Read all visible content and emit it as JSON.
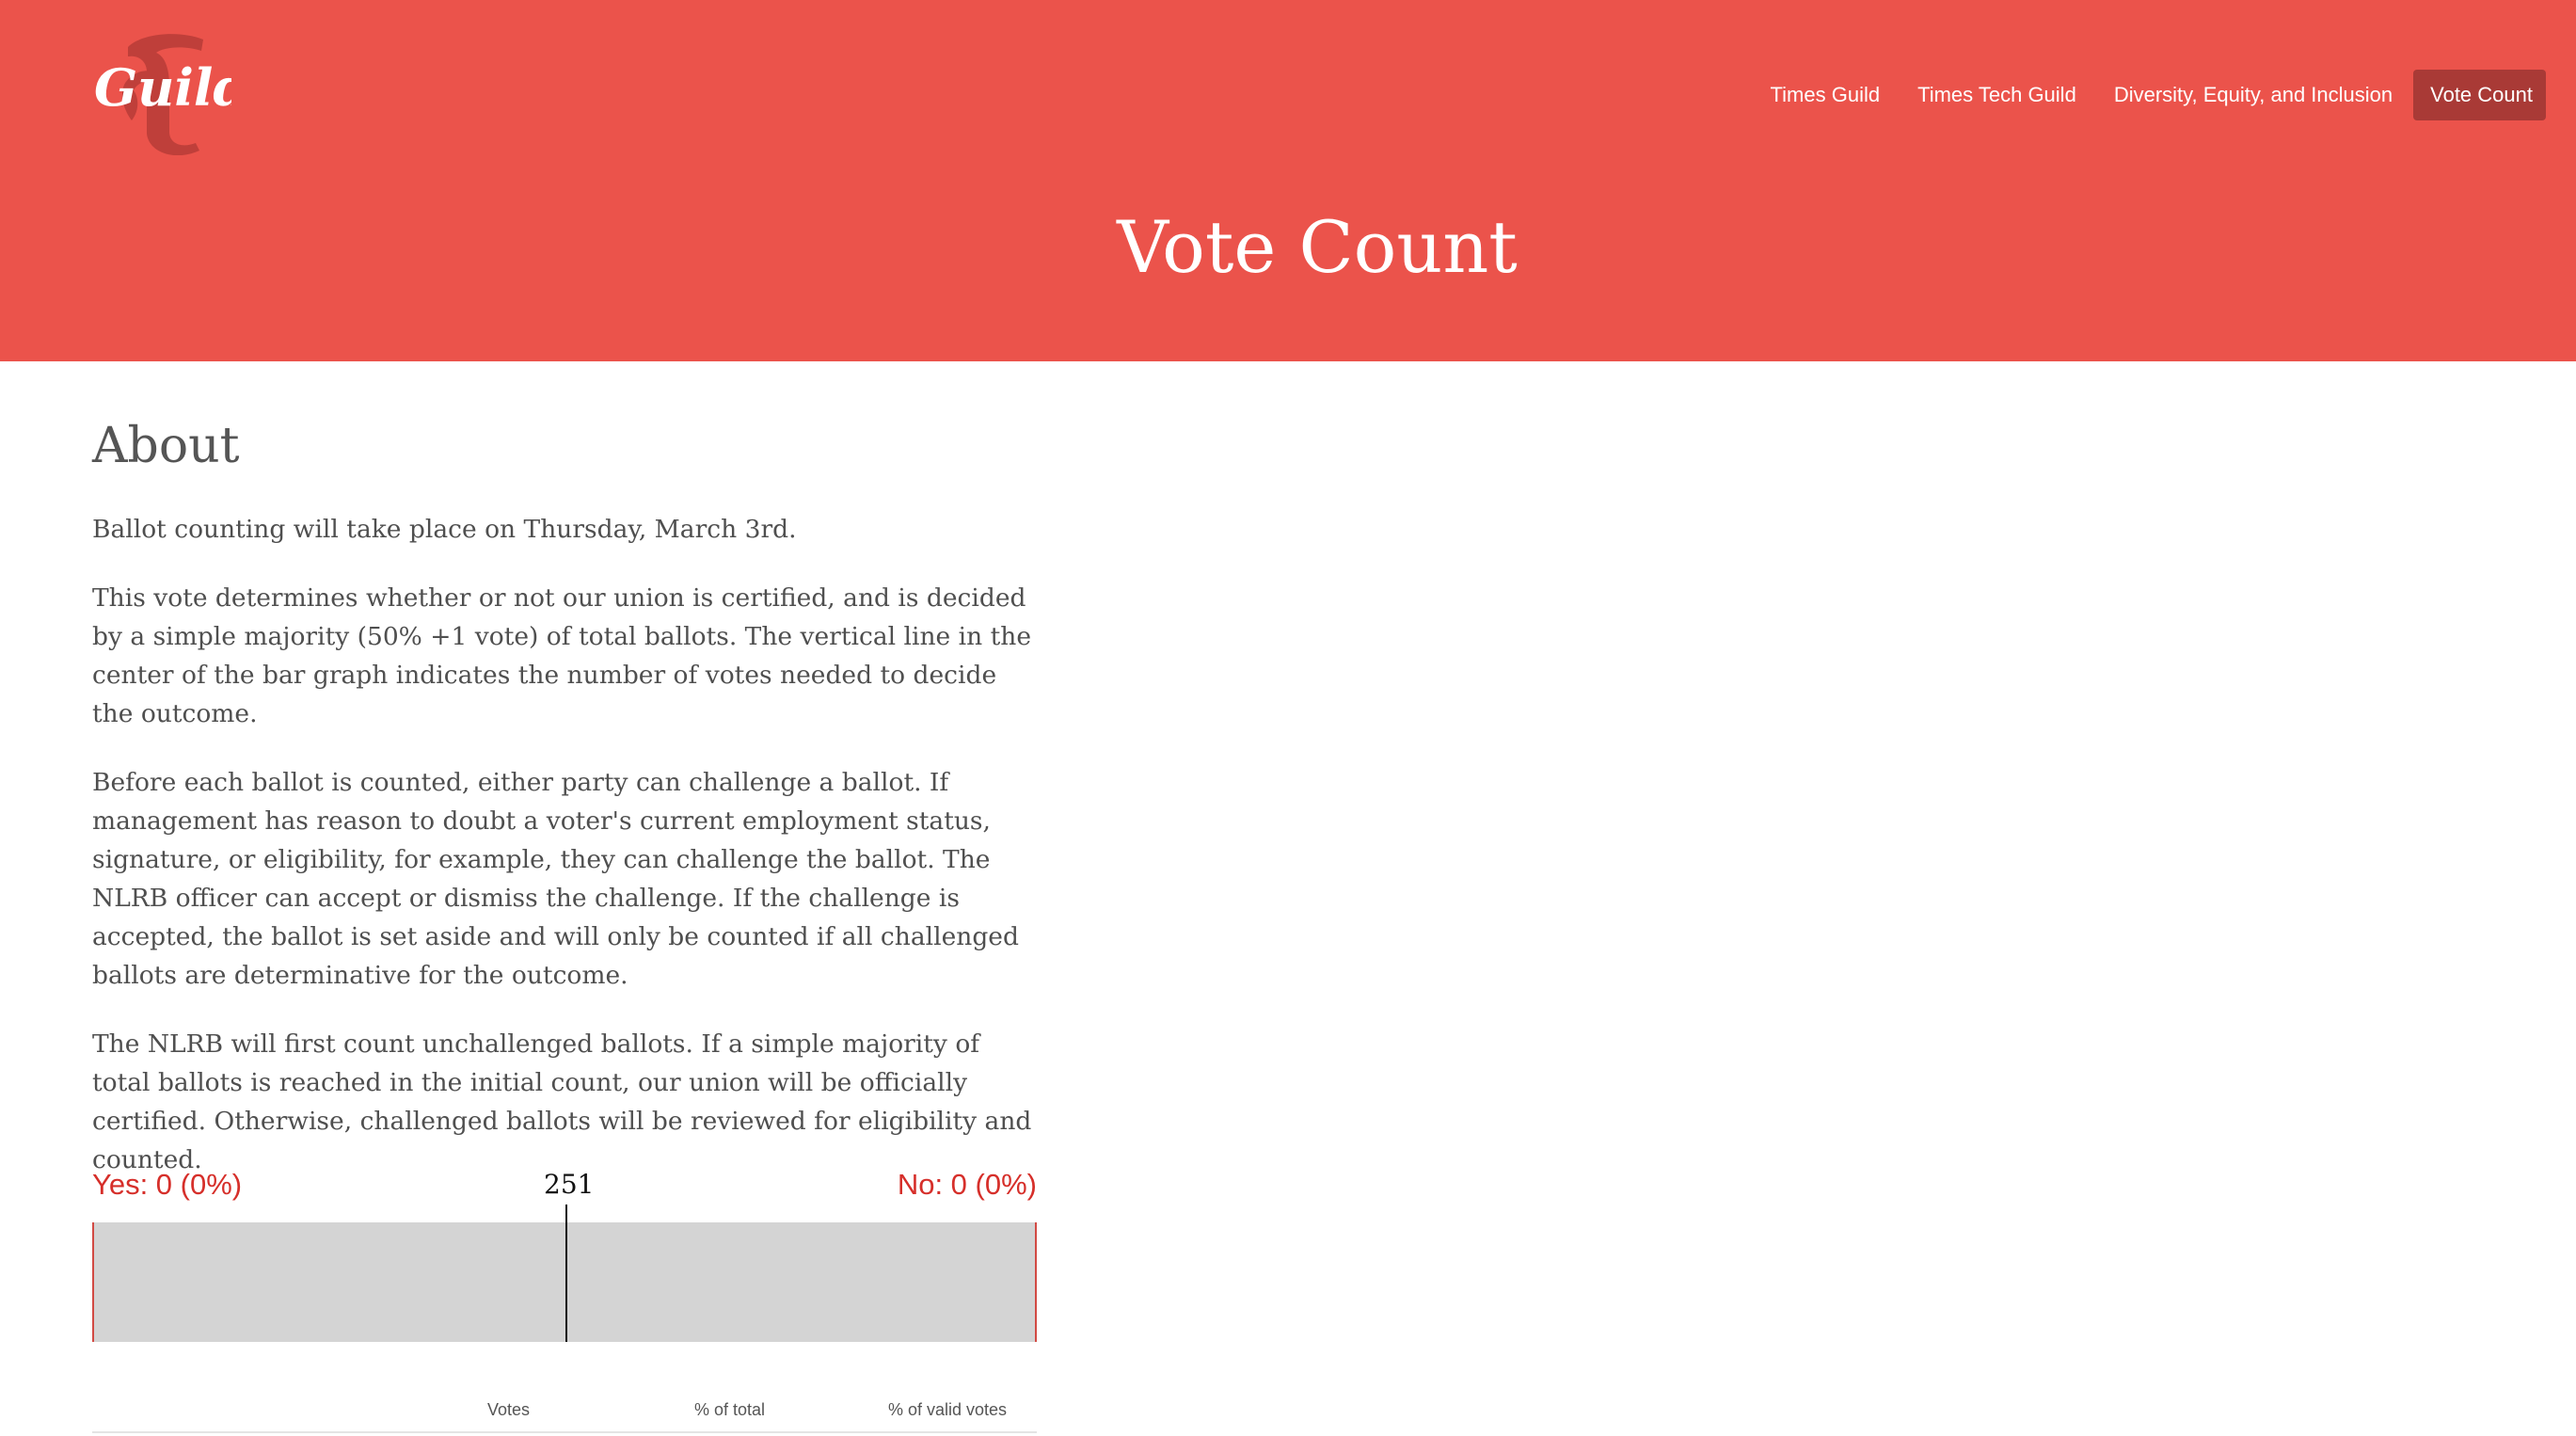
{
  "site": {
    "logo_alt": "Guild",
    "brand_color": "#eb534b",
    "active_color": "#a93a36"
  },
  "nav": {
    "items": [
      {
        "label": "Times Guild",
        "active": false
      },
      {
        "label": "Times Tech Guild",
        "active": false
      },
      {
        "label": "Diversity, Equity, and Inclusion",
        "active": false
      },
      {
        "label": "Vote Count",
        "active": true
      }
    ]
  },
  "hero": {
    "title": "Vote Count"
  },
  "about": {
    "heading": "About",
    "paragraphs": [
      "Ballot counting will take place on Thursday, March 3rd.",
      "This vote determines whether or not our union is certified, and is decided by a simple majority (50% +1 vote) of total ballots. The vertical line in the center of the bar graph indicates the number of votes needed to decide the outcome.",
      "Before each ballot is counted, either party can challenge a ballot. If management has reason to doubt a voter's current employment status, signature, or eligibility, for example, they can challenge the ballot. The NLRB officer can accept or dismiss the challenge. If the challenge is accepted, the ballot is set aside and will only be counted if all challenged ballots are determinative for the outcome.",
      "The NLRB will first count unchallenged ballots. If a simple majority of total ballots is reached in the initial count, our union will be officially certified. Otherwise, challenged ballots will be reviewed for eligibility and counted."
    ]
  },
  "tally": {
    "yes_label": "Yes: 0 (0%)",
    "no_label": "No: 0 (0%)",
    "threshold": "251",
    "yes_votes": 0,
    "no_votes": 0,
    "yes_color": "#d62f2a",
    "bar_color": "#d4d4d4"
  },
  "table": {
    "headers": [
      "Votes",
      "% of total",
      "% of valid votes"
    ]
  }
}
